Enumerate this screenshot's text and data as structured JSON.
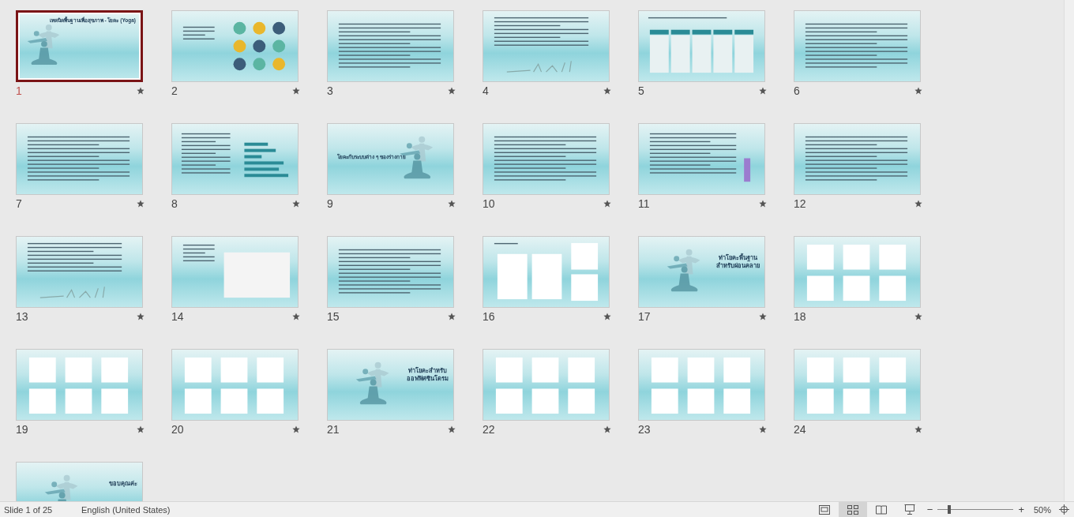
{
  "slides": [
    {
      "number": "1",
      "kind": "cover",
      "title": [
        "เทคนิคพื้นฐานเพื่อสุขภาพ - โยคะ (Yoga)"
      ],
      "selected": true
    },
    {
      "number": "2",
      "kind": "icons",
      "selected": false
    },
    {
      "number": "3",
      "kind": "text",
      "selected": false
    },
    {
      "number": "4",
      "kind": "text-figures",
      "selected": false
    },
    {
      "number": "5",
      "kind": "table",
      "selected": false
    },
    {
      "number": "6",
      "kind": "text",
      "selected": false
    },
    {
      "number": "7",
      "kind": "text",
      "selected": false
    },
    {
      "number": "8",
      "kind": "chart",
      "selected": false
    },
    {
      "number": "9",
      "kind": "section",
      "title": [
        "โยคะกับระบบต่าง ๆ ของร่างกาย"
      ],
      "selected": false
    },
    {
      "number": "10",
      "kind": "text",
      "selected": false
    },
    {
      "number": "11",
      "kind": "text-figure",
      "selected": false
    },
    {
      "number": "12",
      "kind": "text",
      "selected": false
    },
    {
      "number": "13",
      "kind": "text-figures",
      "selected": false
    },
    {
      "number": "14",
      "kind": "text-photo",
      "selected": false
    },
    {
      "number": "15",
      "kind": "text",
      "selected": false
    },
    {
      "number": "16",
      "kind": "photo-collage",
      "selected": false
    },
    {
      "number": "17",
      "kind": "heading",
      "title": [
        "ท่าโยคะพื้นฐาน",
        "สำหรับผ่อนคลาย"
      ],
      "selected": false
    },
    {
      "number": "18",
      "kind": "photo-grid",
      "selected": false
    },
    {
      "number": "19",
      "kind": "photo-grid",
      "selected": false
    },
    {
      "number": "20",
      "kind": "photo-grid",
      "selected": false
    },
    {
      "number": "21",
      "kind": "heading",
      "title": [
        "ท่าโยคะสำหรับ",
        "ออฟฟิศซินโดรม"
      ],
      "selected": false
    },
    {
      "number": "22",
      "kind": "photo-grid",
      "selected": false
    },
    {
      "number": "23",
      "kind": "photo-grid",
      "selected": false
    },
    {
      "number": "24",
      "kind": "photo-grid",
      "selected": false
    },
    {
      "kind": "heading",
      "title": [
        "ขอบคุณค่ะ"
      ],
      "selected": false
    }
  ],
  "status_bar": {
    "slide_info": "Slide 1 of 25",
    "language": "English (United States)",
    "views": [
      {
        "kind": "normal",
        "selected": false
      },
      {
        "kind": "sorter",
        "selected": true
      },
      {
        "kind": "reading",
        "selected": false
      },
      {
        "kind": "slideshow",
        "selected": false
      }
    ],
    "zoom_out": "−",
    "zoom_in": "+",
    "zoom": {
      "level": 0.15
    },
    "zoom_text": "50%"
  }
}
